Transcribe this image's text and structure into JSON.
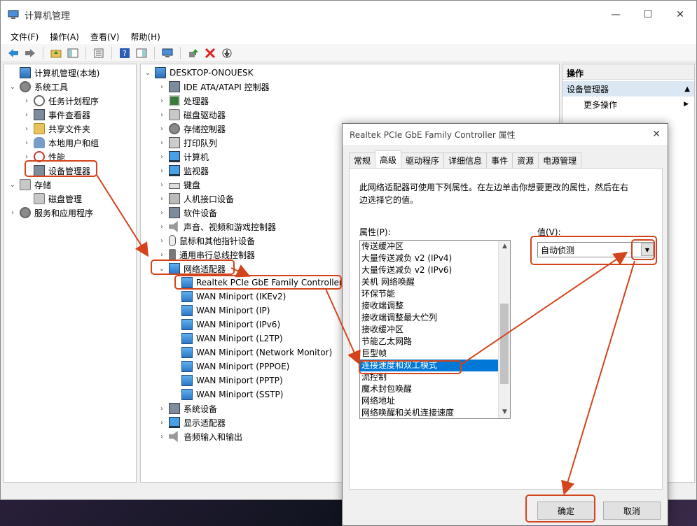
{
  "window": {
    "title": "计算机管理"
  },
  "menu": [
    "文件(F)",
    "操作(A)",
    "查看(V)",
    "帮助(H)"
  ],
  "left_tree": [
    {
      "label": "计算机管理(本地)",
      "icon": "computer-icon",
      "chev": ""
    },
    {
      "label": "系统工具",
      "icon": "tools-icon",
      "chev": "v"
    },
    {
      "label": "任务计划程序",
      "icon": "clock-icon",
      "chev": ">"
    },
    {
      "label": "事件查看器",
      "icon": "event-viewer-icon",
      "chev": ">"
    },
    {
      "label": "共享文件夹",
      "icon": "shared-folder-icon",
      "chev": ">"
    },
    {
      "label": "本地用户和组",
      "icon": "users-icon",
      "chev": ">"
    },
    {
      "label": "性能",
      "icon": "performance-icon",
      "chev": ">"
    },
    {
      "label": "设备管理器",
      "icon": "device-manager-icon",
      "chev": ""
    },
    {
      "label": "存储",
      "icon": "storage-icon",
      "chev": "v"
    },
    {
      "label": "磁盘管理",
      "icon": "disk-icon",
      "chev": ""
    },
    {
      "label": "服务和应用程序",
      "icon": "services-icon",
      "chev": ">"
    }
  ],
  "device_tree": {
    "root": "DESKTOP-ONOUESK",
    "categories": [
      "IDE ATA/ATAPI 控制器",
      "处理器",
      "磁盘驱动器",
      "存储控制器",
      "打印队列",
      "计算机",
      "监视器",
      "键盘",
      "人机接口设备",
      "软件设备",
      "声音、视频和游戏控制器",
      "鼠标和其他指针设备",
      "通用串行总线控制器",
      "网络适配器"
    ],
    "network_adapters": [
      "Realtek PCIe GbE Family Controller",
      "WAN Miniport (IKEv2)",
      "WAN Miniport (IP)",
      "WAN Miniport (IPv6)",
      "WAN Miniport (L2TP)",
      "WAN Miniport (Network Monitor)",
      "WAN Miniport (PPPOE)",
      "WAN Miniport (PPTP)",
      "WAN Miniport (SSTP)"
    ],
    "after": [
      "系统设备",
      "显示适配器",
      "音频输入和输出"
    ]
  },
  "actions": {
    "title": "操作",
    "section": "设备管理器",
    "more": "更多操作"
  },
  "dialog": {
    "title": "Realtek PCIe GbE Family Controller 属性",
    "tabs": [
      "常规",
      "高级",
      "驱动程序",
      "详细信息",
      "事件",
      "资源",
      "电源管理"
    ],
    "description": "此网络适配器可使用下列属性。在左边单击你想要更改的属性，然后在右边选择它的值。",
    "property_label": "属性(P):",
    "value_label": "值(V):",
    "properties": [
      "传送缓冲区",
      "大量传送减负 v2 (IPv4)",
      "大量传送减负 v2 (IPv6)",
      "关机 网络唤醒",
      "环保节能",
      "接收端调整",
      "接收端调整最大伫列",
      "接收缓冲区",
      "节能乙太网路",
      "巨型帧",
      "连接速度和双工模式",
      "流控制",
      "魔术封包唤醒",
      "网络地址",
      "网络唤醒和关机连接速度"
    ],
    "selected_property": "连接速度和双工模式",
    "value": "自动侦测",
    "ok": "确定",
    "cancel": "取消"
  },
  "annotation_color": "#d4441c"
}
